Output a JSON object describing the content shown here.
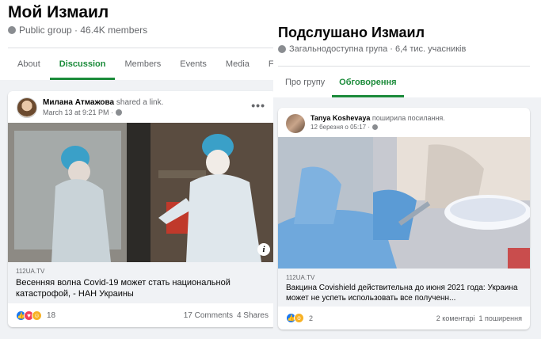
{
  "left": {
    "group": {
      "title": "Мой Измаил",
      "meta": "Public group · 46.4K members"
    },
    "tabs": [
      {
        "label": "About",
        "active": false
      },
      {
        "label": "Discussion",
        "active": true
      },
      {
        "label": "Members",
        "active": false
      },
      {
        "label": "Events",
        "active": false
      },
      {
        "label": "Media",
        "active": false
      },
      {
        "label": "Files",
        "active": false
      }
    ],
    "post": {
      "author": "Милана Атмажова",
      "action": "shared a link.",
      "time": "March 13 at 9:21 PM ·",
      "link_source": "112UA.TV",
      "link_title": "Весенняя волна Covid-19 может стать национальной катастрофой, - НАН Украины",
      "reaction_count": "18",
      "comments": "17 Comments",
      "shares": "4 Shares",
      "reactions": [
        "like",
        "love",
        "haha"
      ]
    }
  },
  "right": {
    "group": {
      "title": "Подслушано Измаил",
      "meta": "Загальнодоступна група · 6,4 тис. учасників"
    },
    "tabs": [
      {
        "label": "Про групу",
        "active": false
      },
      {
        "label": "Обговорення",
        "active": true
      }
    ],
    "post": {
      "author": "Tanya Koshevaya",
      "action": "поширила посилання.",
      "time": "12 березня о 05:17 ·",
      "link_source": "112UA.TV",
      "link_title": "Вакцина Covishield действительна до июня 2021 года: Украина может не успеть использовать все полученн...",
      "reaction_count": "2",
      "comments": "2 коментарі",
      "shares": "1 поширення",
      "reactions": [
        "like",
        "wow"
      ]
    }
  },
  "colors": {
    "accent": "#1b8b3a",
    "like": "#1877f2",
    "love": "#f33e58",
    "haha": "#f7b125",
    "text_secondary": "#65676b",
    "feed_bg": "#f0f2f5"
  },
  "icons": {
    "globe": "globe-icon",
    "more": "more-options-icon",
    "info": "info-icon"
  }
}
